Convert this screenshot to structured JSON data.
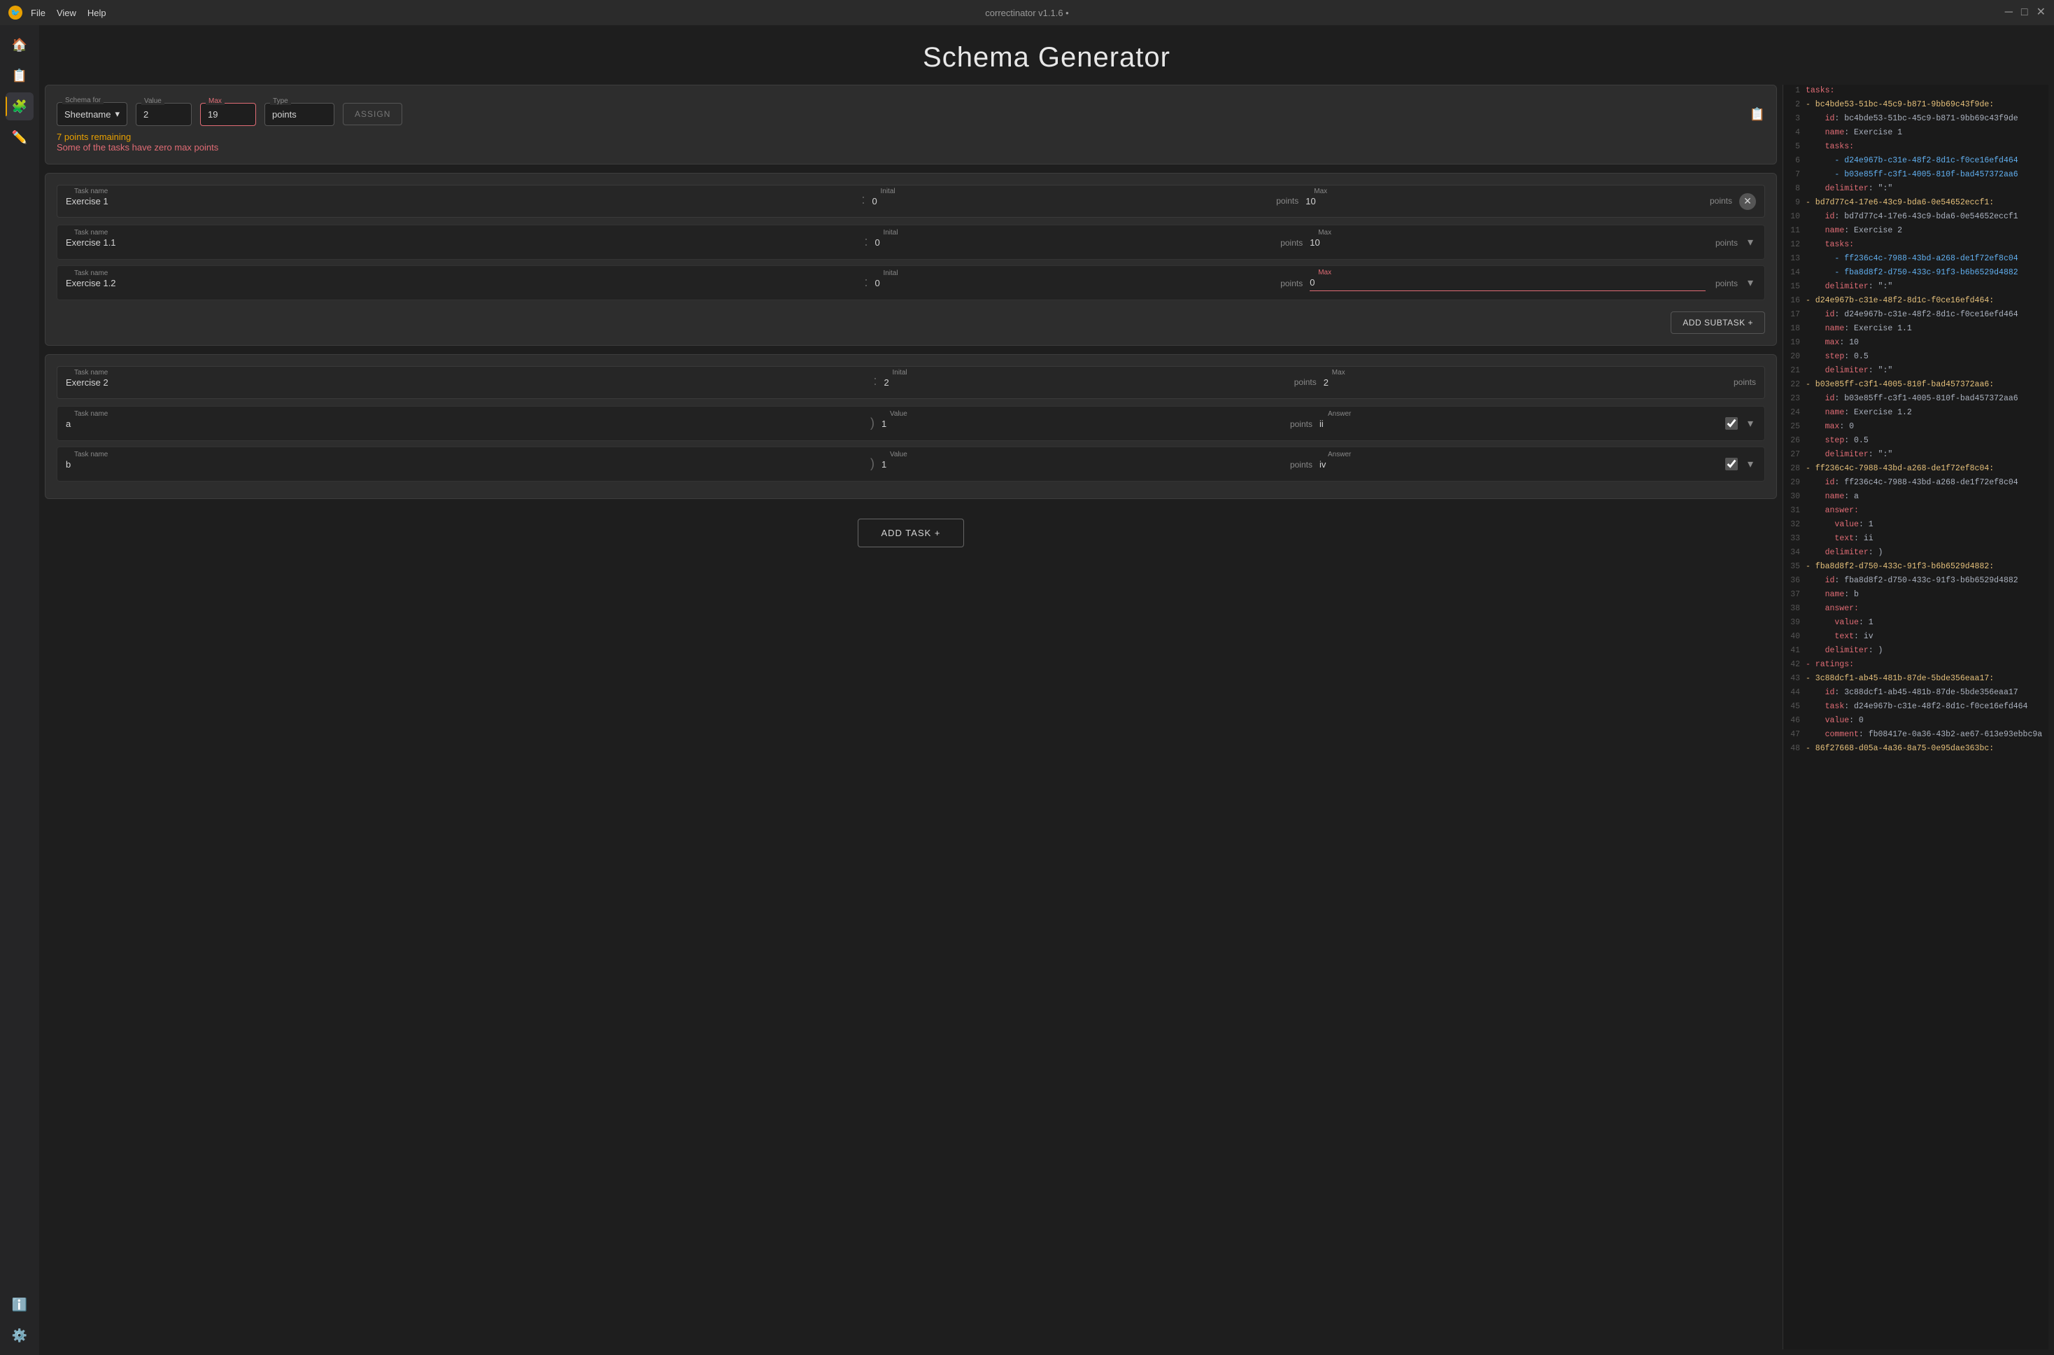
{
  "app": {
    "title": "correctinator v1.1.6 •",
    "menu": [
      "File",
      "View",
      "Help"
    ]
  },
  "page": {
    "title": "Schema Generator"
  },
  "schema_header": {
    "schema_for_label": "Schema for",
    "schema_for_value": "Sheetname",
    "value_label": "Value",
    "value_value": "2",
    "max_label": "Max",
    "max_value": "19",
    "type_label": "Type",
    "type_value": "points",
    "assign_label": "ASSIGN",
    "warning1": "7 points remaining",
    "warning2": "Some of the tasks have zero max points"
  },
  "task1": {
    "task_name_label": "Task name",
    "task_name_value": "Exercise 1",
    "initial_label": "Inital",
    "initial_value": "0",
    "initial_unit": "points",
    "max_label": "Max",
    "max_value": "10",
    "max_unit": "points",
    "subtask1": {
      "task_name_label": "Task name",
      "task_name_value": "Exercise 1.1",
      "initial_label": "Inital",
      "initial_value": "0",
      "initial_unit": "points",
      "max_label": "Max",
      "max_value": "10",
      "max_unit": "points"
    },
    "subtask2": {
      "task_name_label": "Task name",
      "task_name_value": "Exercise 1.2",
      "initial_label": "Inital",
      "initial_value": "0",
      "initial_unit": "points",
      "max_label": "Max",
      "max_value": "0",
      "max_unit": "points"
    },
    "add_subtask_label": "ADD SUBTASK +"
  },
  "task2": {
    "task_name_label": "Task name",
    "task_name_value": "Exercise 2",
    "initial_label": "Inital",
    "initial_value": "2",
    "initial_unit": "points",
    "max_label": "Max",
    "max_value": "2",
    "max_unit": "points",
    "subtask1": {
      "task_name_label": "Task name",
      "task_name_value": "a",
      "separator": ")",
      "value_label": "Value",
      "value_value": "1",
      "value_unit": "points",
      "answer_label": "Answer",
      "answer_value": "ii",
      "checked": true
    },
    "subtask2": {
      "task_name_label": "Task name",
      "task_name_value": "b",
      "separator": ")",
      "value_label": "Value",
      "value_value": "1",
      "value_unit": "points",
      "answer_label": "Answer",
      "answer_value": "iv",
      "checked": true
    }
  },
  "add_task": {
    "label": "ADD TASK +"
  },
  "yaml": {
    "lines": [
      {
        "num": 1,
        "content": "tasks:",
        "type": "key"
      },
      {
        "num": 2,
        "content": "- bc4bde53-51bc-45c9-b871-9bb69c43f9de:",
        "type": "id"
      },
      {
        "num": 3,
        "content": "    id: bc4bde53-51bc-45c9-b871-9bb69c43f9de",
        "type": "normal"
      },
      {
        "num": 4,
        "content": "    name: Exercise 1",
        "type": "normal"
      },
      {
        "num": 5,
        "content": "    tasks:",
        "type": "key"
      },
      {
        "num": 6,
        "content": "      - d24e967b-c31e-48f2-8d1c-f0ce16efd464",
        "type": "bullet"
      },
      {
        "num": 7,
        "content": "      - b03e85ff-c3f1-4005-810f-bad457372aa6",
        "type": "bullet"
      },
      {
        "num": 8,
        "content": "    delimiter: \":\"",
        "type": "normal"
      },
      {
        "num": 9,
        "content": "- bd7d77c4-17e6-43c9-bda6-0e54652eccf1:",
        "type": "id"
      },
      {
        "num": 10,
        "content": "    id: bd7d77c4-17e6-43c9-bda6-0e54652eccf1",
        "type": "normal"
      },
      {
        "num": 11,
        "content": "    name: Exercise 2",
        "type": "normal"
      },
      {
        "num": 12,
        "content": "    tasks:",
        "type": "key"
      },
      {
        "num": 13,
        "content": "      - ff236c4c-7988-43bd-a268-de1f72ef8c04",
        "type": "bullet"
      },
      {
        "num": 14,
        "content": "      - fba8d8f2-d750-433c-91f3-b6b6529d4882",
        "type": "bullet"
      },
      {
        "num": 15,
        "content": "    delimiter: \":\"",
        "type": "normal"
      },
      {
        "num": 16,
        "content": "- d24e967b-c31e-48f2-8d1c-f0ce16efd464:",
        "type": "id"
      },
      {
        "num": 17,
        "content": "    id: d24e967b-c31e-48f2-8d1c-f0ce16efd464",
        "type": "normal"
      },
      {
        "num": 18,
        "content": "    name: Exercise 1.1",
        "type": "normal"
      },
      {
        "num": 19,
        "content": "    max: 10",
        "type": "normal"
      },
      {
        "num": 20,
        "content": "    step: 0.5",
        "type": "normal"
      },
      {
        "num": 21,
        "content": "    delimiter: \":\"",
        "type": "normal"
      },
      {
        "num": 22,
        "content": "- b03e85ff-c3f1-4005-810f-bad457372aa6:",
        "type": "id"
      },
      {
        "num": 23,
        "content": "    id: b03e85ff-c3f1-4005-810f-bad457372aa6",
        "type": "normal"
      },
      {
        "num": 24,
        "content": "    name: Exercise 1.2",
        "type": "normal"
      },
      {
        "num": 25,
        "content": "    max: 0",
        "type": "normal"
      },
      {
        "num": 26,
        "content": "    step: 0.5",
        "type": "normal"
      },
      {
        "num": 27,
        "content": "    delimiter: \":\"",
        "type": "normal"
      },
      {
        "num": 28,
        "content": "- ff236c4c-7988-43bd-a268-de1f72ef8c04:",
        "type": "id"
      },
      {
        "num": 29,
        "content": "    id: ff236c4c-7988-43bd-a268-de1f72ef8c04",
        "type": "normal"
      },
      {
        "num": 30,
        "content": "    name: a",
        "type": "normal"
      },
      {
        "num": 31,
        "content": "    answer:",
        "type": "key"
      },
      {
        "num": 32,
        "content": "      value: 1",
        "type": "normal"
      },
      {
        "num": 33,
        "content": "      text: ii",
        "type": "normal"
      },
      {
        "num": 34,
        "content": "    delimiter: )",
        "type": "normal"
      },
      {
        "num": 35,
        "content": "- fba8d8f2-d750-433c-91f3-b6b6529d4882:",
        "type": "id"
      },
      {
        "num": 36,
        "content": "    id: fba8d8f2-d750-433c-91f3-b6b6529d4882",
        "type": "normal"
      },
      {
        "num": 37,
        "content": "    name: b",
        "type": "normal"
      },
      {
        "num": 38,
        "content": "    answer:",
        "type": "key"
      },
      {
        "num": 39,
        "content": "      value: 1",
        "type": "normal"
      },
      {
        "num": 40,
        "content": "      text: iv",
        "type": "normal"
      },
      {
        "num": 41,
        "content": "    delimiter: )",
        "type": "normal"
      },
      {
        "num": 42,
        "content": "- ratings:",
        "type": "key"
      },
      {
        "num": 43,
        "content": "- 3c88dcf1-ab45-481b-87de-5bde356eaa17:",
        "type": "id"
      },
      {
        "num": 44,
        "content": "    id: 3c88dcf1-ab45-481b-87de-5bde356eaa17",
        "type": "normal"
      },
      {
        "num": 45,
        "content": "    task: d24e967b-c31e-48f2-8d1c-f0ce16efd464",
        "type": "normal"
      },
      {
        "num": 46,
        "content": "    value: 0",
        "type": "normal"
      },
      {
        "num": 47,
        "content": "    comment: fb08417e-0a36-43b2-ae67-613e93ebbc9a",
        "type": "normal"
      },
      {
        "num": 48,
        "content": "- 86f27668-d05a-4a36-8a75-0e95dae363bc:",
        "type": "id"
      }
    ]
  },
  "sidebar": {
    "icons": [
      "🏠",
      "📋",
      "🧩",
      "✏️"
    ],
    "bottom_icons": [
      "ℹ️",
      "⚙️"
    ]
  }
}
